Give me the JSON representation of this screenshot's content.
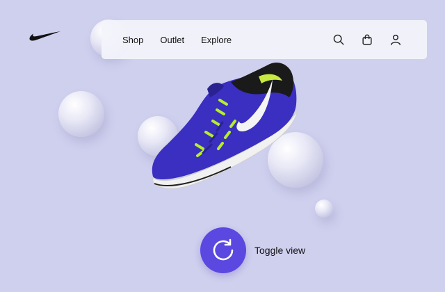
{
  "brand": {
    "logo_icon": "nike-swoosh-icon"
  },
  "nav": {
    "links": [
      {
        "label": "Shop"
      },
      {
        "label": "Outlet"
      },
      {
        "label": "Explore"
      }
    ],
    "icons": [
      "search-icon",
      "shopping-bag-icon",
      "user-icon"
    ]
  },
  "product": {
    "image": "running-shoe-icon"
  },
  "toggle": {
    "label": "Toggle view",
    "icon": "rotate-icon"
  },
  "colors": {
    "background": "#cfcfee",
    "accent": "#5a48e0",
    "shoe_primary": "#3a2fc0",
    "shoe_accent": "#b6ee2c"
  }
}
